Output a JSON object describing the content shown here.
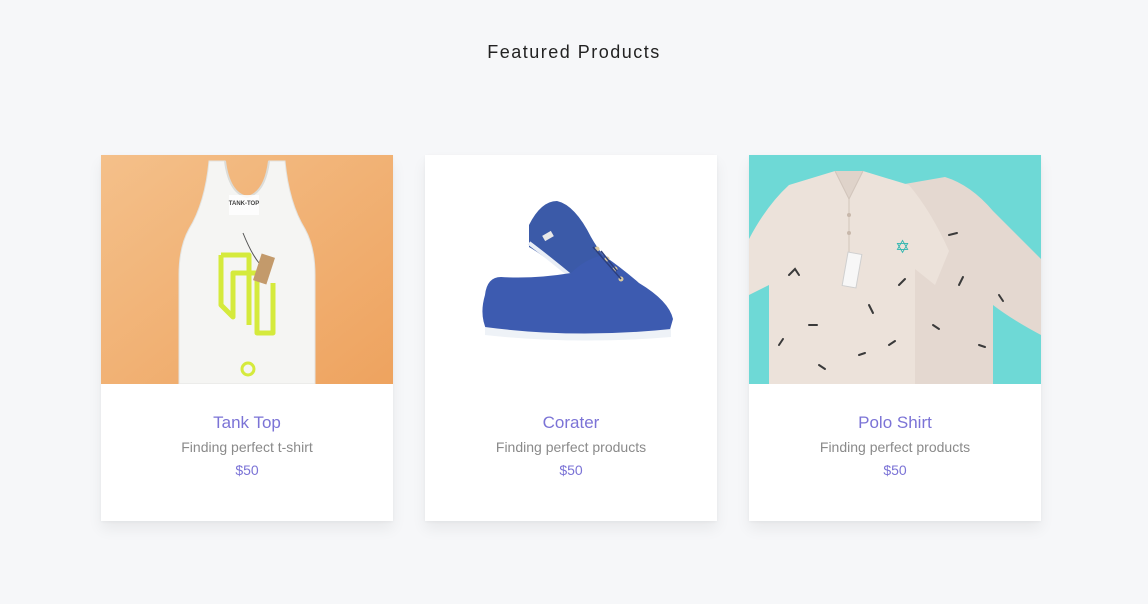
{
  "section": {
    "title": "Featured Products"
  },
  "products": [
    {
      "name": "Tank Top",
      "description": "Finding perfect t-shirt",
      "price": "$50",
      "image_icon": "tank-top-image",
      "image_bg": "#f2b679",
      "tag_text": "TANK-TOP"
    },
    {
      "name": "Corater",
      "description": "Finding perfect products",
      "price": "$50",
      "image_icon": "sneakers-image",
      "image_bg": "#ffffff"
    },
    {
      "name": "Polo Shirt",
      "description": "Finding perfect products",
      "price": "$50",
      "image_icon": "polo-shirt-image",
      "image_bg": "#6ed9d6"
    }
  ],
  "colors": {
    "accent": "#7b73d6",
    "muted_text": "#8a8a8a",
    "page_bg": "#f6f7f9"
  }
}
